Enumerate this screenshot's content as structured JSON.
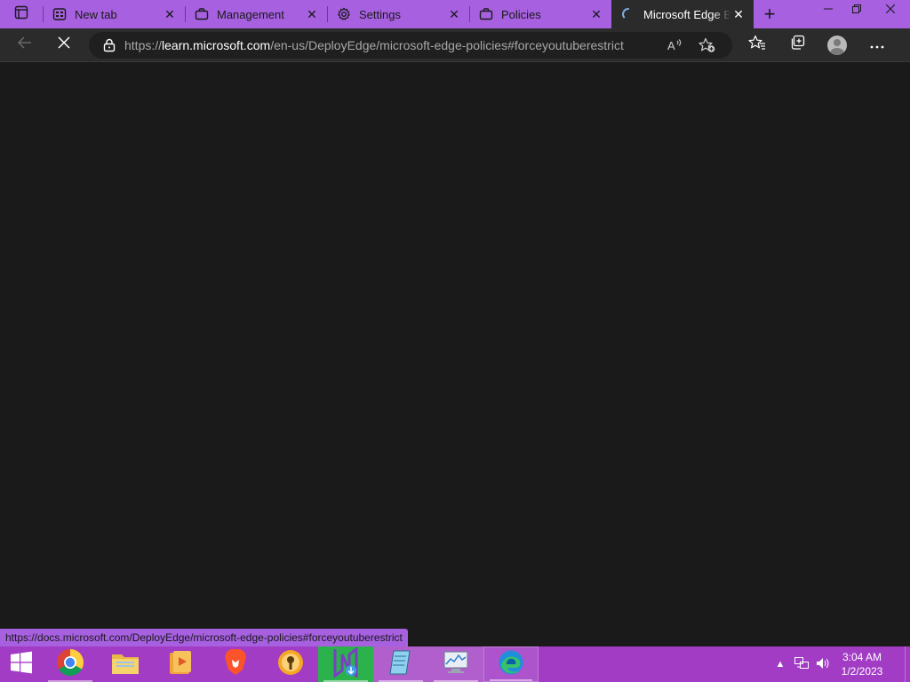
{
  "browser": {
    "tabs": [
      {
        "label": "New tab",
        "icon": "new-tab-icon"
      },
      {
        "label": "Management",
        "icon": "briefcase-icon"
      },
      {
        "label": "Settings",
        "icon": "gear-icon"
      },
      {
        "label": "Policies",
        "icon": "briefcase-icon"
      },
      {
        "label": "Microsoft Edge Br",
        "icon": "loading-spinner-icon",
        "active": true
      }
    ],
    "url": {
      "scheme": "https://",
      "host": "learn.microsoft.com",
      "path": "/en-us/DeployEdge/microsoft-edge-policies#forceyoutuberestrict"
    },
    "status_link": "https://docs.microsoft.com/DeployEdge/microsoft-edge-policies#forceyoutuberestrict",
    "accent_color": "#a660e0",
    "toolbar_color": "#2b2b2b"
  },
  "taskbar": {
    "apps": [
      {
        "name": "chrome"
      },
      {
        "name": "file-explorer"
      },
      {
        "name": "media-player"
      },
      {
        "name": "brave"
      },
      {
        "name": "vpn-key"
      },
      {
        "name": "installer"
      },
      {
        "name": "notepad"
      },
      {
        "name": "resource-monitor"
      },
      {
        "name": "edge",
        "active": true
      }
    ],
    "clock": {
      "time": "3:04 AM",
      "date": "1/2/2023"
    },
    "color": "#a23cc4"
  }
}
